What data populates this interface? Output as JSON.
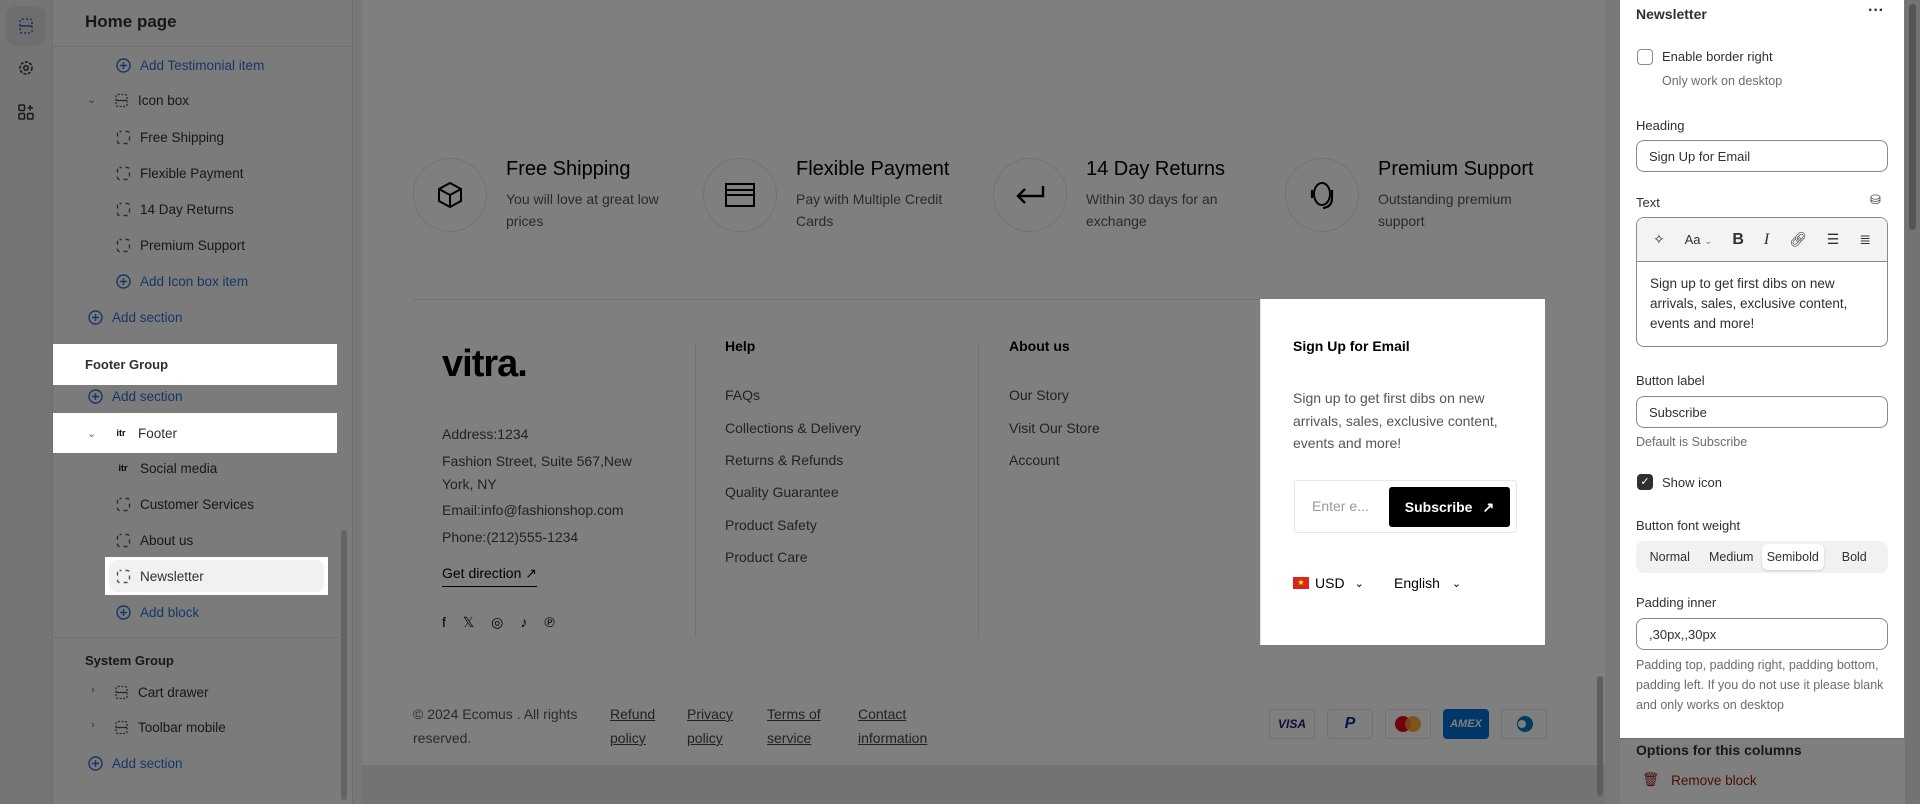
{
  "rail": {
    "icons": [
      "sections-icon",
      "gear-icon",
      "apps-icon"
    ]
  },
  "sidebar": {
    "title": "Home page",
    "items": [
      {
        "label": "Add Testimonial item",
        "type": "add"
      },
      {
        "label": "Icon box",
        "type": "section"
      },
      {
        "label": "Free Shipping",
        "type": "block"
      },
      {
        "label": "Flexible Payment",
        "type": "block"
      },
      {
        "label": "14 Day Returns",
        "type": "block"
      },
      {
        "label": "Premium Support",
        "type": "block"
      },
      {
        "label": "Add Icon box item",
        "type": "add"
      },
      {
        "label": "Add section",
        "type": "add"
      }
    ],
    "footer_group": {
      "label": "Footer Group",
      "add_section": "Add section",
      "footer": "Footer",
      "blocks": [
        "Social media",
        "Customer Services",
        "About us",
        "Newsletter"
      ],
      "add_block": "Add block"
    },
    "system_group": {
      "label": "System Group",
      "items": [
        "Cart drawer",
        "Toolbar mobile"
      ],
      "add_section": "Add section"
    }
  },
  "preview": {
    "icon_boxes": [
      {
        "title": "Free Shipping",
        "desc": "You will love at great low prices",
        "icon": "box-icon"
      },
      {
        "title": "Flexible Payment",
        "desc": "Pay with Multiple Credit Cards",
        "icon": "credit-card-icon"
      },
      {
        "title": "14 Day Returns",
        "desc": "Within 30 days for an exchange",
        "icon": "return-arrow-icon"
      },
      {
        "title": "Premium Support",
        "desc": "Outstanding premium support",
        "icon": "headset-icon"
      }
    ],
    "logo": "vitra.",
    "address": [
      "Address:1234",
      "Fashion Street, Suite 567,New",
      "York, NY",
      "Email:info@fashionshop.com",
      "Phone:(212)555-1234"
    ],
    "get_direction": "Get direction",
    "help": {
      "title": "Help",
      "links": [
        "FAQs",
        "Collections & Delivery",
        "Returns & Refunds",
        "Quality Guarantee",
        "Product Safety",
        "Product Care"
      ]
    },
    "about": {
      "title": "About us",
      "links": [
        "Our Story",
        "Visit Our Store",
        "Account"
      ]
    },
    "newsletter": {
      "heading": "Sign Up for Email",
      "text": "Sign up to get first dibs on new arrivals, sales, exclusive content, events and more!",
      "placeholder": "Enter e...",
      "button": "Subscribe",
      "currency": "USD",
      "language": "English"
    },
    "copyright_1": "© 2024 Ecomus . All rights",
    "copyright_2": "reserved.",
    "bottom_links": [
      [
        "Refund",
        "policy"
      ],
      [
        "Privacy",
        "policy"
      ],
      [
        "Terms of",
        "service"
      ],
      [
        "Contact",
        "information"
      ]
    ],
    "payments": [
      "VISA",
      "PayPal",
      "Mastercard",
      "AMEX",
      "Diners"
    ]
  },
  "panel": {
    "title": "Newsletter",
    "enable_border": {
      "label": "Enable border right",
      "help": "Only work on desktop",
      "checked": false
    },
    "heading_label": "Heading",
    "heading_value": "Sign Up for Email",
    "text_label": "Text",
    "text_value": "Sign up to get first dibs on new arrivals, sales, exclusive content, events and more!",
    "button_label_label": "Button label",
    "button_label_value": "Subscribe",
    "button_label_help": "Default is Subscribe",
    "show_icon": {
      "label": "Show icon",
      "checked": true
    },
    "font_weight_label": "Button font weight",
    "font_weight_options": [
      "Normal",
      "Medium",
      "Semibold",
      "Bold"
    ],
    "font_weight_selected": "Semibold",
    "padding_label": "Padding inner",
    "padding_value": ",30px,,30px",
    "padding_help": "Padding top, padding right, padding bottom, padding left. If you do not use it please blank and only works on desktop",
    "options_heading": "Options for this columns",
    "remove_block": "Remove block"
  },
  "colors": {
    "accent": "#2c6ecb",
    "danger": "#8e1f0b",
    "overlay": "rgba(0,0,0,0.5)"
  }
}
